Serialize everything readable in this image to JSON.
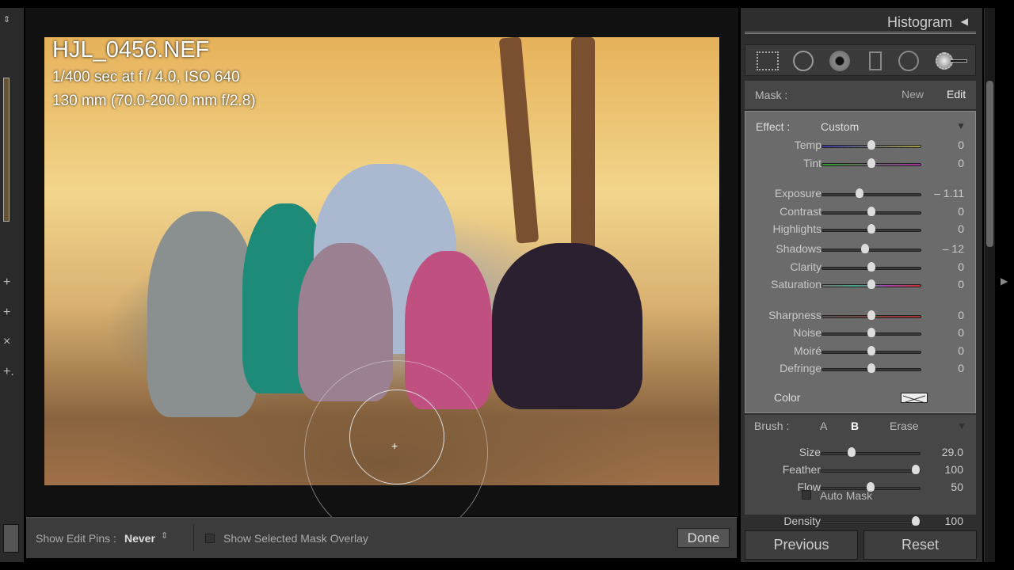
{
  "photo": {
    "filename": "HJL_0456.NEF",
    "exposure_info": "1/400 sec at f / 4.0, ISO 640",
    "lens_info": "130 mm (70.0-200.0 mm f/2.8)"
  },
  "toolbar": {
    "edit_pins_label": "Show Edit Pins :",
    "edit_pins_value": "Never",
    "overlay_label": "Show Selected Mask Overlay",
    "overlay_checked": false,
    "done": "Done"
  },
  "panel": {
    "header": "Histogram",
    "tools": [
      "crop-overlay",
      "spot-removal",
      "red-eye",
      "graduated-filter",
      "radial-filter",
      "adjustment-brush"
    ],
    "mask": {
      "label": "Mask :",
      "new": "New",
      "edit": "Edit"
    },
    "effect": {
      "label": "Effect :",
      "value": "Custom"
    },
    "sliders": [
      {
        "name": "Temp",
        "value": "0",
        "pos": 0.5
      },
      {
        "name": "Tint",
        "value": "0",
        "pos": 0.5
      },
      {
        "name": "Exposure",
        "value": "– 1.11",
        "pos": 0.38
      },
      {
        "name": "Contrast",
        "value": "0",
        "pos": 0.5
      },
      {
        "name": "Highlights",
        "value": "0",
        "pos": 0.5
      },
      {
        "name": "Shadows",
        "value": "– 12",
        "pos": 0.44
      },
      {
        "name": "Clarity",
        "value": "0",
        "pos": 0.5
      },
      {
        "name": "Saturation",
        "value": "0",
        "pos": 0.5
      },
      {
        "name": "Sharpness",
        "value": "0",
        "pos": 0.5
      },
      {
        "name": "Noise",
        "value": "0",
        "pos": 0.5
      },
      {
        "name": "Moiré",
        "value": "0",
        "pos": 0.5
      },
      {
        "name": "Defringe",
        "value": "0",
        "pos": 0.5
      }
    ],
    "color_label": "Color",
    "brush": {
      "label": "Brush :",
      "a": "A",
      "b": "B",
      "erase": "Erase",
      "sliders": [
        {
          "name": "Size",
          "value": "29.0",
          "pos": 0.31
        },
        {
          "name": "Feather",
          "value": "100",
          "pos": 0.95
        },
        {
          "name": "Flow",
          "value": "50",
          "pos": 0.5
        },
        {
          "name": "Density",
          "value": "100",
          "pos": 0.95
        }
      ],
      "auto_mask": "Auto Mask",
      "auto_mask_checked": false
    },
    "previous": "Previous",
    "reset": "Reset"
  }
}
